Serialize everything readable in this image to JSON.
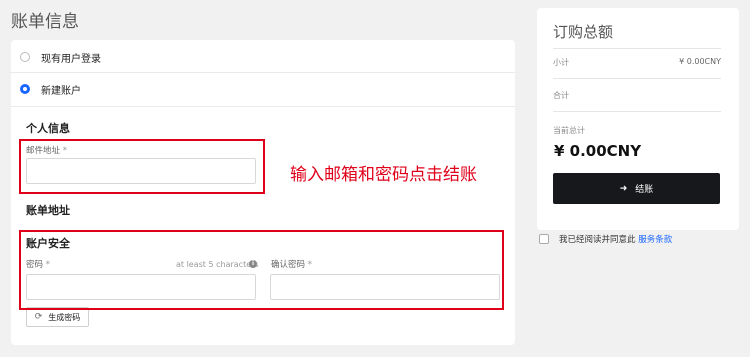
{
  "page": {
    "title": "账单信息"
  },
  "account_options": [
    {
      "label": "现有用户登录",
      "selected": false
    },
    {
      "label": "新建账户",
      "selected": true
    }
  ],
  "personal_info": {
    "title": "个人信息",
    "email_label": "邮件地址",
    "email_required": "*",
    "email_value": ""
  },
  "billing_address": {
    "title": "账单地址"
  },
  "account_security": {
    "title": "账户安全",
    "password_label": "密码",
    "password_required": "*",
    "password_hint": "at least 5 characters",
    "confirm_label": "确认密码",
    "confirm_required": "*",
    "generate_button": "生成密码"
  },
  "annotation": {
    "text": "输入邮箱和密码点击结账",
    "color": "#e0001a"
  },
  "order_summary": {
    "title": "订购总额",
    "subtotal_label": "小计",
    "subtotal_value": "¥ 0.00CNY",
    "total_label": "合计",
    "current_total_label": "当前总计",
    "current_total_value": "¥ 0.00CNY",
    "checkout_button": "结账"
  },
  "terms": {
    "prefix": "我已经阅读并同意此",
    "link": "服务条款",
    "checked": false
  },
  "colors": {
    "accent": "#1a66ff",
    "highlight": "#e0001a",
    "checkout": "#16181b"
  },
  "icons": {
    "checkout": "arrow-right-icon",
    "generate": "refresh-icon",
    "hint": "info-icon"
  }
}
